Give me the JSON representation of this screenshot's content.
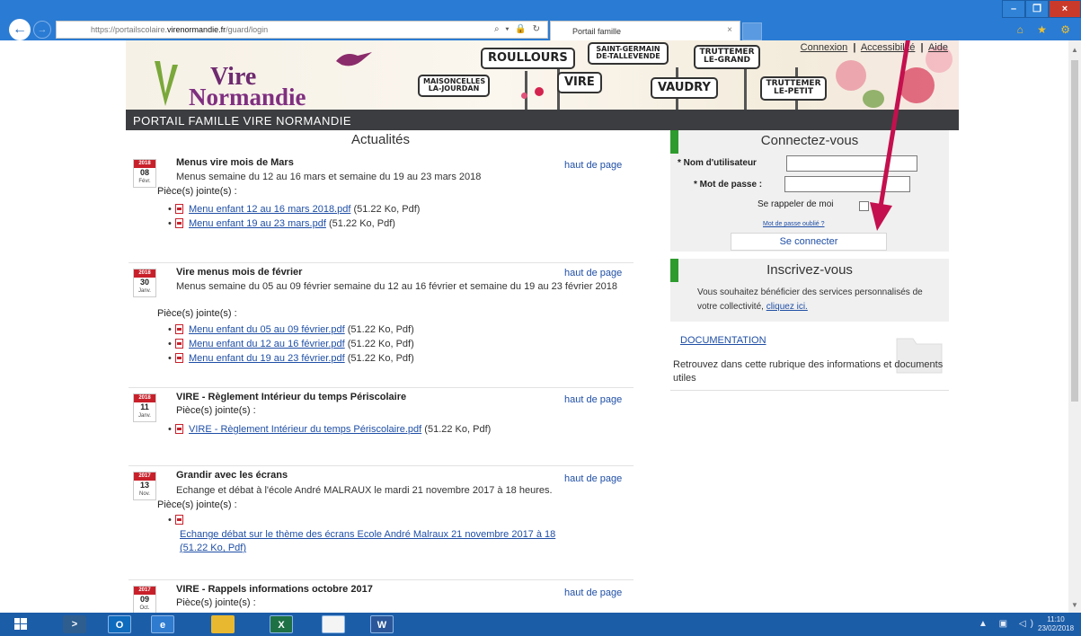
{
  "browser": {
    "url_prefix": "https://portailscolaire.",
    "url_domain": "virenormandie.fr",
    "url_path": "/guard/login",
    "address_icons": "⌕ ▾ 🔒 ↻",
    "tab_title": "Portail famille",
    "tab_close": "×",
    "minimize": "–",
    "maximize": "❐",
    "close": "×",
    "toolbar_icons": "⌂ ★ ⚙"
  },
  "header": {
    "logo_line1": "Vire",
    "logo_line2": "Normandie",
    "links": [
      "Connexion",
      "Accessibilité",
      "Aide"
    ],
    "separator": "|",
    "signs": [
      "ROULLOURS",
      "SAINT-GERMAIN DE-TALLEVENDE",
      "TRUTTEMER LE-GRAND",
      "MAISONCELLES LA-JOURDAN",
      "VIRE",
      "VAUDRY",
      "TRUTTEMER LE-PETIT"
    ]
  },
  "portal_title": "PORTAIL FAMILLE VIRE NORMANDIE",
  "news": {
    "heading": "Actualités",
    "top_link": "haut de page",
    "attachments_label": "Pièce(s) jointe(s) :",
    "articles": [
      {
        "year": "2018",
        "day": "08",
        "month": "Févr.",
        "title": "Menus vire mois de Mars",
        "desc": "Menus semaine du 12 au 16 mars et semaine du 19 au 23 mars 2018",
        "attachments": [
          {
            "name": "Menu enfant 12 au 16 mars 2018.pdf",
            "info": "(51.22 Ko, Pdf)"
          },
          {
            "name": "Menu enfant 19 au 23 mars.pdf",
            "info": "(51.22 Ko, Pdf)"
          }
        ]
      },
      {
        "year": "2018",
        "day": "30",
        "month": "Janv.",
        "title": "Vire menus mois de février",
        "desc": "Menus semaine du 05 au 09 février semaine du 12 au 16 février et semaine du 19 au 23 février 2018",
        "attachments": [
          {
            "name": "Menu enfant du 05 au 09 février.pdf",
            "info": "(51.22 Ko, Pdf)"
          },
          {
            "name": "Menu enfant du 12 au 16 février.pdf",
            "info": "(51.22 Ko, Pdf)"
          },
          {
            "name": "Menu enfant du 19 au 23 février.pdf",
            "info": "(51.22 Ko, Pdf)"
          }
        ]
      },
      {
        "year": "2018",
        "day": "11",
        "month": "Janv.",
        "title": "VIRE - Règlement Intérieur du temps Périscolaire",
        "desc": "",
        "attachments": [
          {
            "name": "VIRE - Règlement Intérieur du temps Périscolaire.pdf",
            "info": "(51.22 Ko, Pdf)"
          }
        ]
      },
      {
        "year": "2017",
        "day": "13",
        "month": "Nov.",
        "title": "Grandir avec les écrans",
        "desc": "Echange et débat à l'école André MALRAUX le mardi 21 novembre 2017 à 18 heures.",
        "attachments": [
          {
            "name": "Echange débat sur le thème des écrans Ecole André Malraux 21 novembre 2017 à 18",
            "info": "(51.22 Ko, Pdf)"
          }
        ]
      },
      {
        "year": "2017",
        "day": "09",
        "month": "Oct.",
        "title": "VIRE - Rappels informations octobre 2017",
        "desc": "",
        "attachments": []
      }
    ]
  },
  "login": {
    "heading": "Connectez-vous",
    "username_label": "* Nom d'utilisateur",
    "password_label": "* Mot de passe :",
    "username_value": "",
    "password_value": "",
    "remember_label": "Se rappeler de moi",
    "forgot_link": "Mot de passe oublié ?",
    "submit": "Se connecter"
  },
  "register": {
    "heading": "Inscrivez-vous",
    "text": "Vous souhaitez bénéficier des services personnalisés de votre collectivité,",
    "link": "cliquez ici."
  },
  "documentation": {
    "title": "DOCUMENTATION",
    "desc": "Retrouvez dans cette rubrique des informations et documents utiles"
  },
  "taskbar": {
    "time": "11:10",
    "date": "23/02/2018",
    "tray_icons": "▲ ▣ ◁)"
  },
  "colors": {
    "accent_green": "#2e9b2e",
    "date_red": "#c8202a",
    "link_blue": "#1f4fa6",
    "annotation": "#c4104e"
  }
}
